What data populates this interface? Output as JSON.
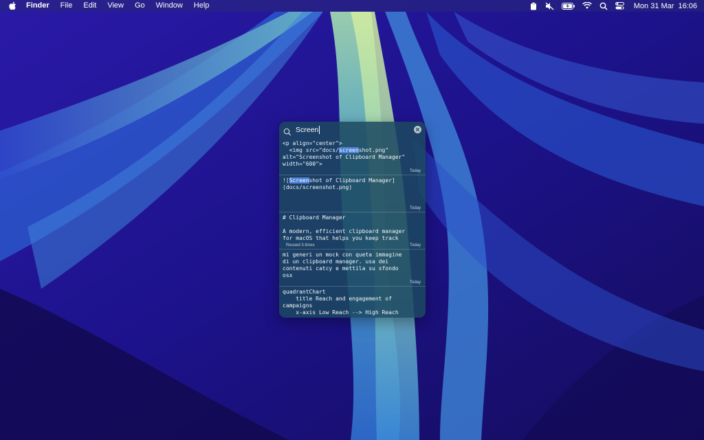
{
  "menubar": {
    "app_name": "Finder",
    "menus": [
      "File",
      "Edit",
      "View",
      "Go",
      "Window",
      "Help"
    ],
    "icons": [
      "apple-icon",
      "clipboard-icon",
      "mute-icon",
      "battery-icon",
      "wifi-icon",
      "search-icon",
      "control-center-icon"
    ],
    "date": "Mon 31 Mar",
    "time": "16:06"
  },
  "search": {
    "query": "Screen",
    "icon": "search-icon",
    "clear_icon": "clear-icon"
  },
  "items": [
    {
      "lines": [
        "<p align=\"center\">",
        "  <img src=\"docs/",
        "screen",
        "shot.png\"",
        "alt=\"Screenshot of Clipboard Manager\"",
        "width=\"600\">"
      ],
      "date": "Today"
    },
    {
      "lines": [
        "![",
        "Screen",
        "shot of Clipboard Manager]",
        "(docs/screenshot.png)"
      ],
      "date": "Today"
    },
    {
      "lines": [
        "# Clipboard Manager",
        "",
        "A modern, efficient clipboard manager",
        "for macOS that helps you keep track"
      ],
      "reused": "Reused 3 times",
      "date": "Today"
    },
    {
      "lines": [
        "mi generi un mock con queta immagine",
        "di un clipboard manager. usa dei",
        "contenuti catcy e mettila su sfondo",
        "osx"
      ],
      "date": "Today"
    },
    {
      "lines": [
        "quadrantChart",
        "    title Reach and engagement of",
        "campaigns",
        "    x-axis Low Reach --> High Reach"
      ]
    }
  ],
  "colors": {
    "wallpaper_base": "#1a0f6e",
    "wallpaper_ribbon": "#3f86d8",
    "panel_bg": "#1c4860",
    "highlight": "#4a7fd6"
  }
}
